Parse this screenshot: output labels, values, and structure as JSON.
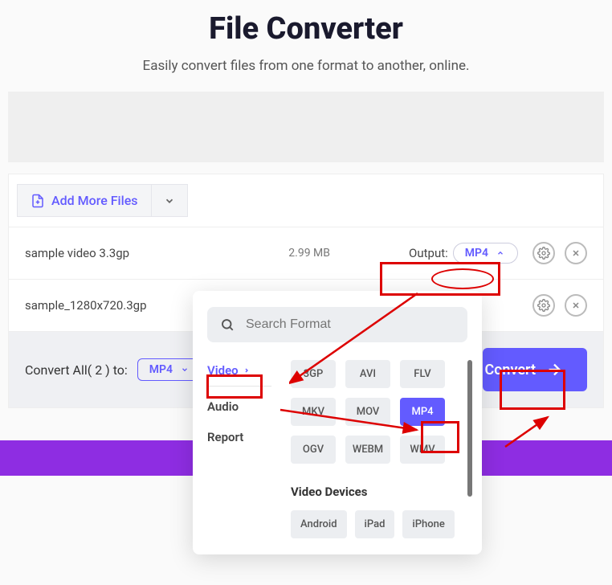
{
  "header": {
    "title": "File Converter",
    "subtitle": "Easily convert files from one format to another, online."
  },
  "toolbar": {
    "add_more": "Add More Files"
  },
  "files": [
    {
      "name": "sample video 3.3gp",
      "size": "2.99 MB",
      "output_label": "Output:",
      "output_format": "MP4"
    },
    {
      "name": "sample_1280x720.3gp",
      "size": "",
      "output_label": "",
      "output_format": ""
    }
  ],
  "convert_all": {
    "label_prefix": "Convert All( ",
    "count": "2",
    "label_suffix": " ) to:",
    "format": "MP4",
    "button": "Convert"
  },
  "popup": {
    "search_placeholder": "Search Format",
    "categories": [
      {
        "label": "Video",
        "active": true
      },
      {
        "label": "Audio",
        "active": false
      },
      {
        "label": "Report",
        "active": false
      }
    ],
    "video_formats": [
      "3GP",
      "AVI",
      "FLV",
      "MKV",
      "MOV",
      "MP4",
      "OGV",
      "WEBM",
      "WMV"
    ],
    "selected_format": "MP4",
    "devices_heading": "Video Devices",
    "devices": [
      "Android",
      "iPad",
      "iPhone"
    ]
  }
}
